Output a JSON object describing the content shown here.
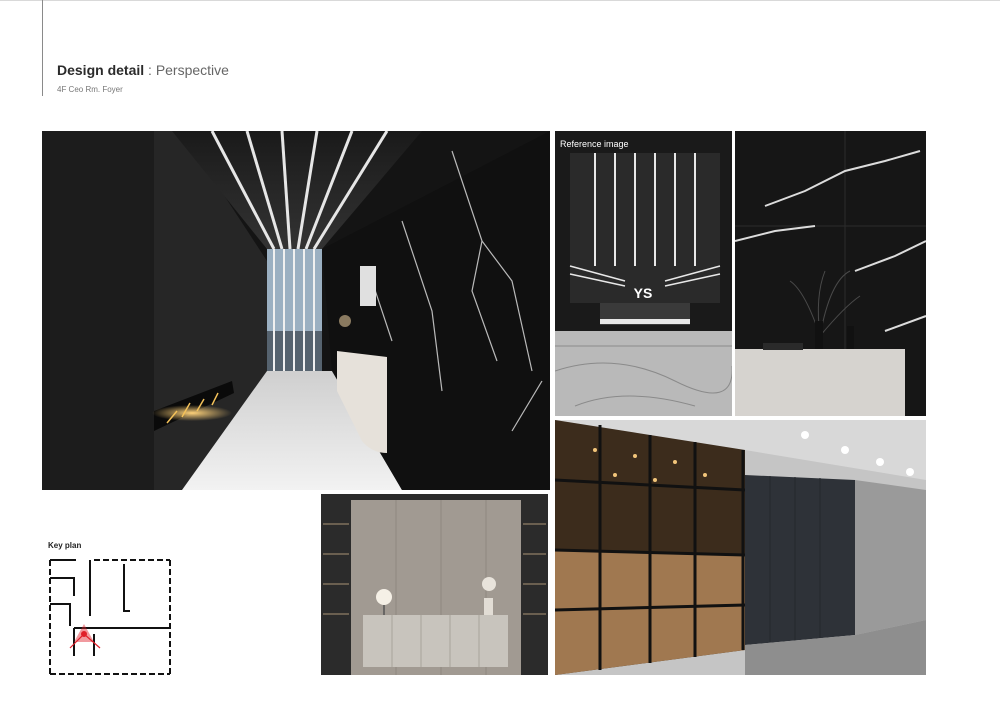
{
  "header": {
    "title_bold": "Design detail",
    "title_separator": ":",
    "title_light": "Perspective",
    "subtitle": "4F Ceo Rm. Foyer"
  },
  "reference": {
    "label": "Reference image",
    "logo_text": "YS"
  },
  "keyplan": {
    "label": "Key plan"
  },
  "colors": {
    "accent_marker": "#e0202a",
    "dark_stone": "#141414",
    "veining": "#d8d8d8"
  }
}
